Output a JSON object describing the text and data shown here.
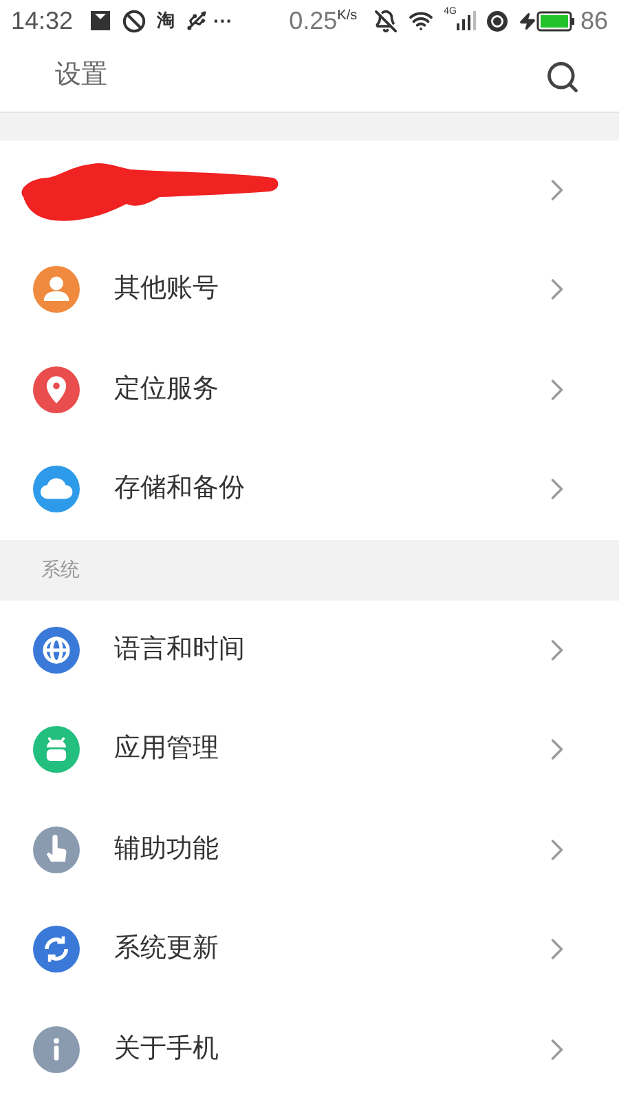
{
  "status_bar": {
    "time": "14:32",
    "app_glyph": "淘",
    "more": "···",
    "speed": "0.25",
    "speed_unit": "K/s",
    "network": "4G",
    "battery": "86"
  },
  "header": {
    "title": "设置"
  },
  "sections": [
    {
      "items": [
        {
          "kind": "redacted"
        },
        {
          "kind": "item",
          "label": "其他账号",
          "color": "#f08a3e"
        },
        {
          "kind": "item",
          "label": "定位服务",
          "color": "#ea4d4d"
        },
        {
          "kind": "item",
          "label": "存储和备份",
          "color": "#2e9bea"
        }
      ]
    },
    {
      "title": "系统",
      "items": [
        {
          "kind": "item",
          "label": "语言和时间",
          "color": "#3a79d8"
        },
        {
          "kind": "item",
          "label": "应用管理",
          "color": "#22bf7e"
        },
        {
          "kind": "item",
          "label": "辅助功能",
          "color": "#8a9bb0"
        },
        {
          "kind": "item",
          "label": "系统更新",
          "color": "#3a79d8"
        },
        {
          "kind": "item",
          "label": "关于手机",
          "color": "#8a9bb0"
        }
      ]
    }
  ]
}
